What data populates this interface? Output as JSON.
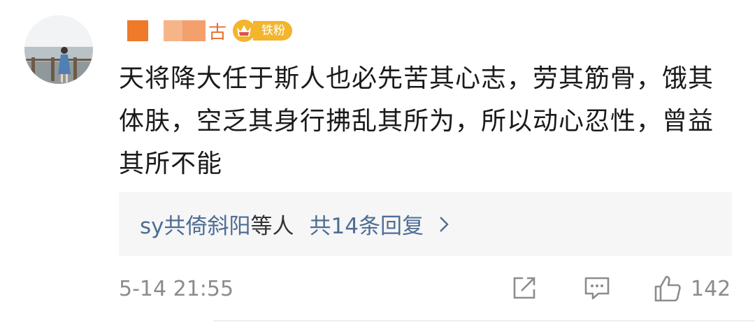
{
  "user": {
    "name_tail": "古",
    "badge_label": "铁粉"
  },
  "comment": {
    "text": "天将降大任于斯人也必先苦其心志，劳其筋骨，饿其体肤，空乏其身行拂乱其所为，所以动心忍性，曾益其所不能"
  },
  "replies": {
    "user": "sy共倚斜阳",
    "connector": "等人",
    "count_text": "共14条回复"
  },
  "footer": {
    "timestamp": "5-14 21:55",
    "like_count": "142"
  },
  "icons": {
    "badge": "crown-icon",
    "share": "share-icon",
    "comment": "comment-icon",
    "like": "thumbs-up-icon",
    "chevron": "chevron-right-icon"
  },
  "colors": {
    "link": "#4e6d94",
    "meta": "#8c8c8c",
    "badge": "#f2b52b",
    "reply_bg": "#f6f6f6"
  }
}
